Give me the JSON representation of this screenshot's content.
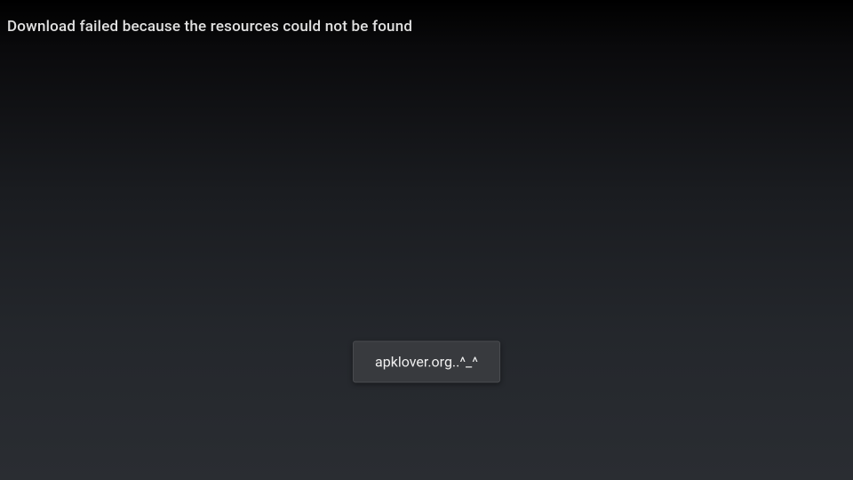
{
  "error": {
    "message": "Download failed because the resources could not be found"
  },
  "toast": {
    "text": "apklover.org..^_^"
  }
}
